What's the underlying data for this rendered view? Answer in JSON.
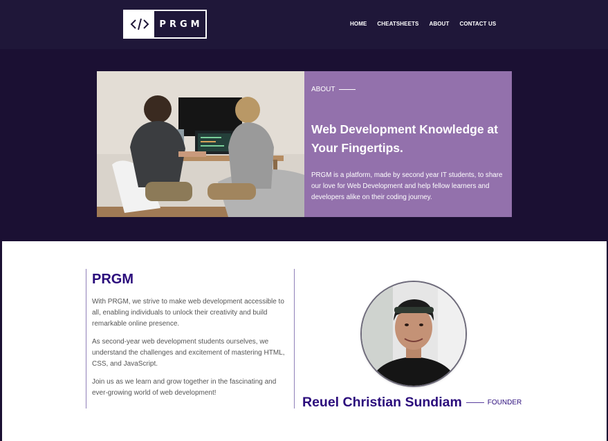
{
  "brand": {
    "logo_text": "PRGM",
    "logo_icon": "code-icon"
  },
  "nav": {
    "items": [
      "HOME",
      "CHEATSHEETS",
      "ABOUT",
      "CONTACT US"
    ]
  },
  "hero": {
    "label": "ABOUT",
    "title": "Web Development Knowledge at Your Fingertips.",
    "text": "PRGM is a platform, made by second year IT students, to share our love for Web Development and help fellow learners and developers alike on their coding journey."
  },
  "about": {
    "title": "PRGM",
    "paragraphs": [
      "With PRGM, we strive to make web development accessible to all, enabling individuals to unlock their creativity and build remarkable online presence.",
      "As second-year web development students ourselves, we understand the challenges and excitement of mastering HTML, CSS, and JavaScript.",
      "Join us as we learn and grow together in the fascinating and ever-growing world of web development!"
    ]
  },
  "founder": {
    "name": "Reuel Christian Sundiam",
    "role": "FOUNDER"
  },
  "colors": {
    "header_bg": "#1f1739",
    "hero_bg": "#1b1033",
    "card": "#9371ac",
    "accent": "#2b0c7c"
  }
}
